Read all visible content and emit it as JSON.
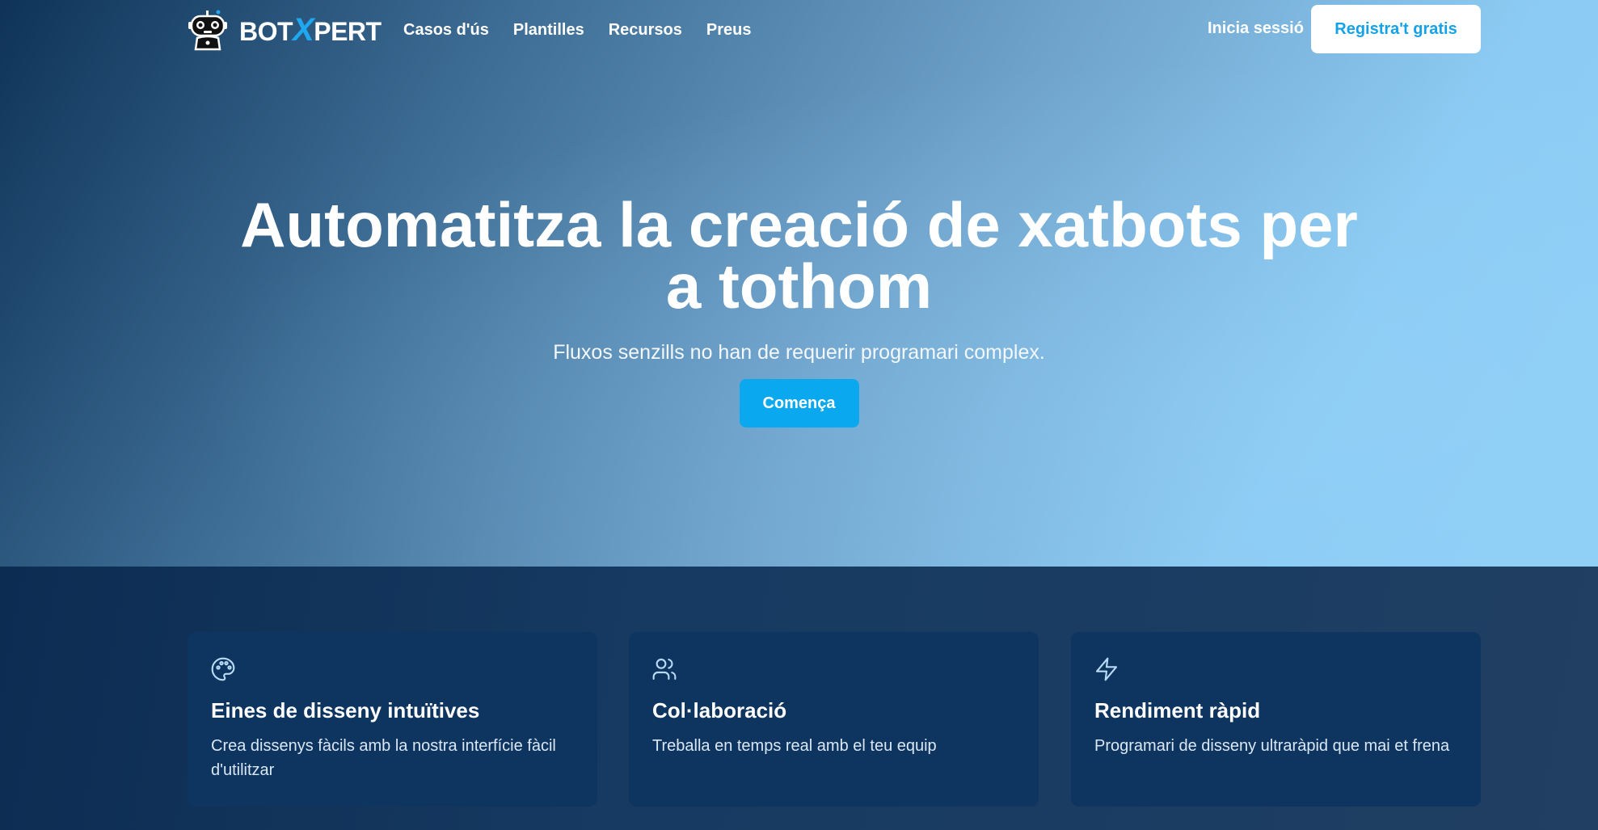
{
  "brand": {
    "name_prefix": "BOT",
    "name_x": "X",
    "name_suffix": "PERT",
    "logo_icon": "robot-icon"
  },
  "nav": {
    "links": [
      {
        "label": "Casos d'ús"
      },
      {
        "label": "Plantilles"
      },
      {
        "label": "Recursos"
      },
      {
        "label": "Preus"
      }
    ],
    "login_label": "Inicia sessió",
    "signup_label": "Registra't gratis"
  },
  "hero": {
    "title": "Automatitza la creació de xatbots per a tothom",
    "subtitle": "Fluxos senzills no han de requerir programari complex.",
    "cta_label": "Comença"
  },
  "features": [
    {
      "icon": "palette-icon",
      "title": "Eines de disseny intuïtives",
      "description": "Crea dissenys fàcils amb la nostra interfície fàcil d'utilitzar"
    },
    {
      "icon": "users-icon",
      "title": "Col·laboració",
      "description": "Treballa en temps real amb el teu equip"
    },
    {
      "icon": "lightning-icon",
      "title": "Rendiment ràpid",
      "description": "Programari de disseny ultraràpid que mai et frena"
    }
  ],
  "colors": {
    "accent": "#0aa8ee",
    "signup_text": "#15a2e8",
    "card_bg": "#0e3460",
    "features_bg": "#163a62"
  }
}
